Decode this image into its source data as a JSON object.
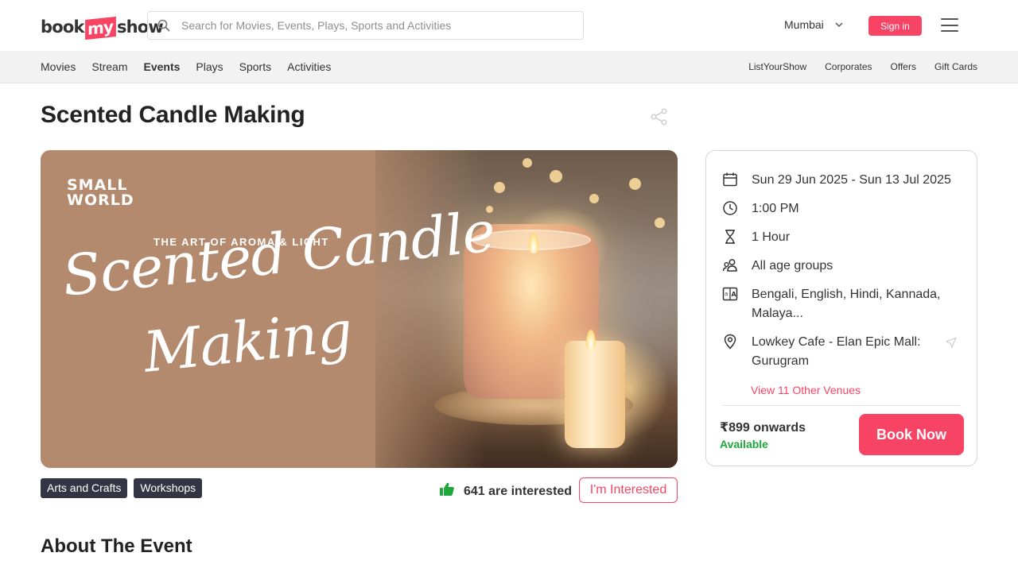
{
  "brand": {
    "part1": "book",
    "part2": "my",
    "part3": "show",
    "accent": "#f84464"
  },
  "search": {
    "placeholder": "Search for Movies, Events, Plays, Sports and Activities",
    "value": ""
  },
  "header": {
    "city": "Mumbai",
    "sign_in": "Sign in"
  },
  "nav": {
    "left": [
      "Movies",
      "Stream",
      "Events",
      "Plays",
      "Sports",
      "Activities"
    ],
    "active": "Events",
    "right": [
      "ListYourShow",
      "Corporates",
      "Offers",
      "Gift Cards"
    ]
  },
  "event": {
    "title": "Scented Candle Making",
    "banner": {
      "brand_line1": "SMALL",
      "brand_line2": "WORLD",
      "tagline": "THE ART OF AROMA & LIGHT",
      "script_line1": "Scented Candle",
      "script_line2": "Making"
    },
    "tags": [
      "Arts and Crafts",
      "Workshops"
    ],
    "interested_count": "641 are interested",
    "interested_button": "I'm Interested"
  },
  "details": {
    "date": "Sun 29 Jun 2025 - Sun 13 Jul 2025",
    "time": "1:00 PM",
    "duration": "1 Hour",
    "age": "All age groups",
    "languages": "Bengali, English, Hindi, Kannada, Malaya...",
    "venue": "Lowkey Cafe - Elan Epic Mall: Gurugram",
    "other_venues": "View 11 Other Venues",
    "price": "₹899 onwards",
    "availability": "Available",
    "book_button": "Book Now"
  },
  "about_heading": "About The Event",
  "icons": [
    "search-icon",
    "chevron-down-icon",
    "menu-icon",
    "share-icon",
    "calendar-icon",
    "clock-icon",
    "hourglass-icon",
    "people-icon",
    "language-icon",
    "location-pin-icon",
    "navigate-arrow-icon",
    "thumbs-up-icon"
  ]
}
